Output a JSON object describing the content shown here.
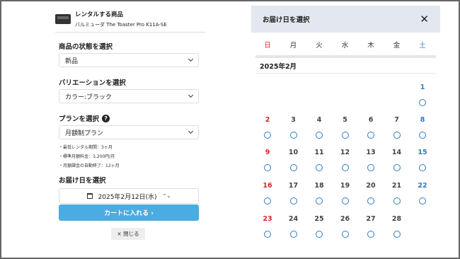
{
  "product": {
    "title": "レンタルする商品",
    "name": "バルミューダ The Toaster Pro K11A-SE"
  },
  "condition": {
    "label": "商品の状態を選択",
    "value": "新品"
  },
  "variation": {
    "label": "バリエーションを選択",
    "value": "カラー:ブラック"
  },
  "plan": {
    "label": "プランを選択",
    "help": "?",
    "value": "月額制プラン",
    "notes": [
      "・最低レンタル期間：3ヶ月",
      "・標準月額料金：3,200円/月",
      "・月額課金の自動終了：12ヶ月"
    ]
  },
  "delivery": {
    "label": "お届け日を選択",
    "value": "2025年2月12日(水)",
    "updown": "⌃⌄"
  },
  "cart_button": "カートに入れる ›",
  "close_button": "× 閉じる",
  "calendar": {
    "title": "お届け日を選択",
    "close_icon": "✕",
    "month": "2025年2月",
    "weekdays": [
      "日",
      "月",
      "火",
      "水",
      "木",
      "金",
      "土"
    ],
    "weeks": [
      [
        "",
        "",
        "",
        "",
        "",
        "",
        "1"
      ],
      [
        "2",
        "3",
        "4",
        "5",
        "6",
        "7",
        "8"
      ],
      [
        "9",
        "10",
        "11",
        "12",
        "13",
        "14",
        "15"
      ],
      [
        "16",
        "17",
        "18",
        "19",
        "20",
        "21",
        "22"
      ],
      [
        "23",
        "24",
        "25",
        "26",
        "27",
        "28",
        ""
      ]
    ],
    "colors": {
      "sunday": "#d62828",
      "saturday": "#2e7bbf",
      "available": "#2e7bbf",
      "header_bg": "#e3e8f0",
      "button": "#4aace0"
    }
  }
}
